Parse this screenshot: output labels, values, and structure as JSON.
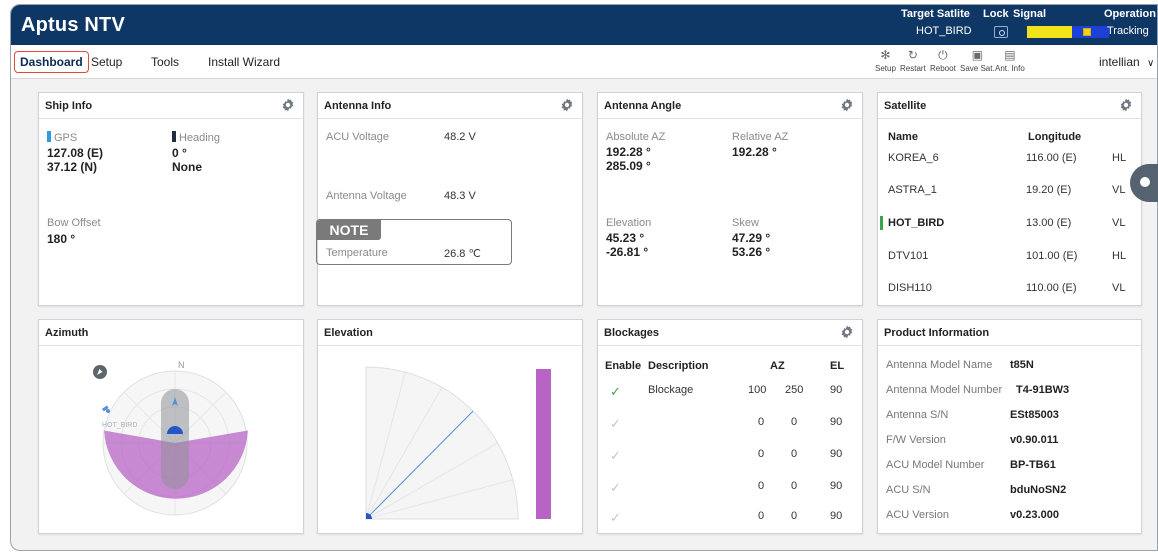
{
  "header": {
    "app_title": "Aptus NTV",
    "target_satellite_label": "Target Satlite",
    "target_satellite_value": "HOT_BIRD",
    "lock_label": "Lock",
    "signal_label": "Signal",
    "signal_level": 0.55,
    "operation_label": "Operation",
    "operation_value": "Tracking"
  },
  "menu": {
    "items": [
      "Dashboard",
      "Setup",
      "Tools",
      "Install Wizard"
    ],
    "active": "Dashboard",
    "toolbar": [
      "Setup",
      "Restart",
      "Reboot",
      "Save Sat.",
      "Ant. Info"
    ],
    "user": "intellian"
  },
  "ship_info": {
    "title": "Ship Info",
    "gps_label": "GPS",
    "gps_lon": "127.08 (E)",
    "gps_lat": "37.12 (N)",
    "heading_label": "Heading",
    "heading_value": "0 °",
    "heading_source": "None",
    "bow_offset_label": "Bow Offset",
    "bow_offset_value": "180 °",
    "gps_color": "#2f9be0",
    "heading_color": "#1f2d3d"
  },
  "antenna_info": {
    "title": "Antenna Info",
    "acu_voltage_label": "ACU Voltage",
    "acu_voltage_value": "48.2 V",
    "antenna_voltage_label": "Antenna Voltage",
    "antenna_voltage_value": "48.3 V",
    "note_label": "NOTE",
    "temperature_label": "Temperature",
    "temperature_value": "26.8 ℃"
  },
  "antenna_angle": {
    "title": "Antenna Angle",
    "absolute_az_label": "Absolute AZ",
    "absolute_az_1": "192.28 °",
    "absolute_az_2": "285.09 °",
    "relative_az_label": "Relative AZ",
    "relative_az_value": "192.28 °",
    "elevation_label": "Elevation",
    "elevation_1": "45.23 °",
    "elevation_2": "-26.81 °",
    "skew_label": "Skew",
    "skew_1": "47.29 °",
    "skew_2": "53.26 °"
  },
  "satellite": {
    "title": "Satellite",
    "col_name": "Name",
    "col_longitude": "Longitude",
    "rows": [
      {
        "name": "KOREA_6",
        "lon": "116.00 (E)",
        "pol": "HL"
      },
      {
        "name": "ASTRA_1",
        "lon": "19.20 (E)",
        "pol": "VL"
      },
      {
        "name": "HOT_BIRD",
        "lon": "13.00 (E)",
        "pol": "VL"
      },
      {
        "name": "DTV101",
        "lon": "101.00 (E)",
        "pol": "HL"
      },
      {
        "name": "DISH110",
        "lon": "110.00 (E)",
        "pol": "VL"
      }
    ],
    "active_index": 2,
    "active_color": "#3aa54a"
  },
  "azimuth": {
    "title": "Azimuth",
    "north_label": "N",
    "satellite_label": "HOT_BIRD",
    "blockage_color": "#b764c4"
  },
  "elevation_panel": {
    "title": "Elevation",
    "elevation_deg": 45.23,
    "bar_color": "#b764c4",
    "line_color": "#5b8fd6"
  },
  "blockages": {
    "title": "Blockages",
    "col_enable": "Enable",
    "col_description": "Description",
    "col_az": "AZ",
    "col_el": "EL",
    "rows": [
      {
        "enabled": true,
        "description": "Blockage",
        "az_start": "100",
        "az_end": "250",
        "el": "90"
      },
      {
        "enabled": false,
        "description": "",
        "az_start": "",
        "az_end": "0",
        "el": "90",
        "az_mid": "0"
      },
      {
        "enabled": false,
        "description": "",
        "az_start": "",
        "az_end": "0",
        "el": "90",
        "az_mid": "0"
      },
      {
        "enabled": false,
        "description": "",
        "az_start": "",
        "az_end": "0",
        "el": "90",
        "az_mid": "0"
      },
      {
        "enabled": false,
        "description": "",
        "az_start": "",
        "az_end": "0",
        "el": "90",
        "az_mid": "0"
      }
    ],
    "check_on_color": "#3aa54a",
    "check_off_color": "#c7c7c7"
  },
  "product_info": {
    "title": "Product Information",
    "rows": [
      {
        "key": "Antenna Model Name",
        "value": "t85N"
      },
      {
        "key": "Antenna Model Number",
        "value": "T4-91BW3"
      },
      {
        "key": "Antenna S/N",
        "value": "ESt85003"
      },
      {
        "key": "F/W Version",
        "value": "v0.90.011"
      },
      {
        "key": "ACU Model Number",
        "value": "BP-TB61"
      },
      {
        "key": "ACU S/N",
        "value": "bduNoSN2"
      },
      {
        "key": "ACU Version",
        "value": "v0.23.000"
      }
    ]
  },
  "icons": {
    "gear": "gear-icon",
    "compass": "compass-icon",
    "satellite": "satellite-icon",
    "lock": "lock-icon"
  }
}
